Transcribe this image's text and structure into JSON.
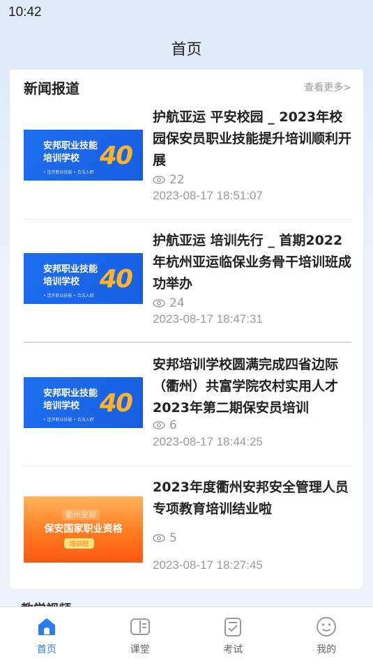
{
  "status_bar": {
    "time": "10:42"
  },
  "header": {
    "title": "首页"
  },
  "news_section": {
    "title": "新闻报道",
    "more_label": "查看更多>",
    "items": [
      {
        "title": "护航亚运 平安校园 _ 2023年校园保安员职业技能提升培训顺利开展",
        "views": "22",
        "date": "2023-08-17 18:51:07",
        "thumb": {
          "style": "blue",
          "line1": "安邦职业技能",
          "line2": "培训学校",
          "badge": "40",
          "footer": "• 连开职业技能 • 合法入职"
        }
      },
      {
        "title": "护航亚运 培训先行 _ 首期2022年杭州亚运临保业务骨干培训班成功举办",
        "views": "24",
        "date": "2023-08-17 18:47:31",
        "thumb": {
          "style": "blue",
          "line1": "安邦职业技能",
          "line2": "培训学校",
          "badge": "40",
          "footer": "• 连开职业技能 • 合法入职"
        }
      },
      {
        "title": "安邦培训学校圆满完成四省边际（衢州）共富学院农村实用人才2023年第二期保安员培训",
        "views": "6",
        "date": "2023-08-17 18:44:25",
        "thumb": {
          "style": "blue",
          "line1": "安邦职业技能",
          "line2": "培训学校",
          "badge": "40",
          "footer": "• 连开职业技能 • 合法入职"
        }
      },
      {
        "title": "2023年度衢州安邦安全管理人员专项教育培训结业啦",
        "views": "5",
        "date": "2023-08-17 18:27:45",
        "thumb": {
          "style": "orange",
          "line1": "衢州安邦",
          "line2": "保安国家职业资格",
          "tag": "培训班"
        }
      }
    ]
  },
  "next_section": {
    "title": "教学视频"
  },
  "tabbar": {
    "items": [
      {
        "label": "首页",
        "icon": "home-icon",
        "active": true
      },
      {
        "label": "课堂",
        "icon": "book-icon",
        "active": false
      },
      {
        "label": "考试",
        "icon": "exam-icon",
        "active": false
      },
      {
        "label": "我的",
        "icon": "profile-icon",
        "active": false
      }
    ],
    "active_color": "#2a7cf0",
    "inactive_color": "#999999"
  }
}
